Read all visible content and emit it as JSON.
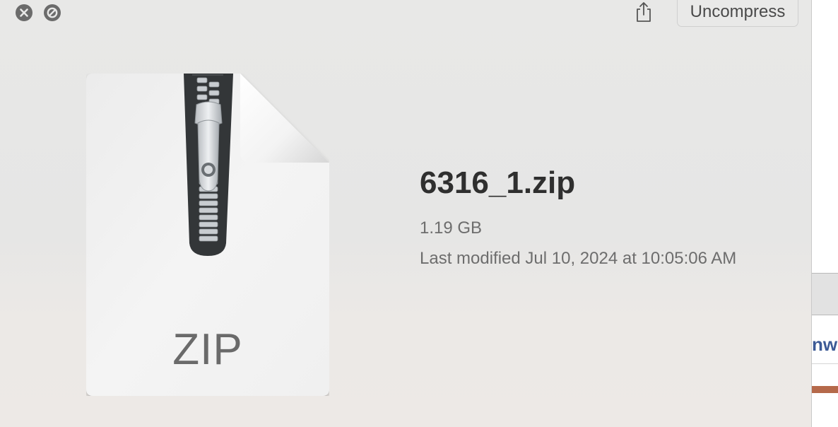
{
  "toolbar": {
    "close_icon": "close-icon",
    "disable_icon": "circle-slash-icon",
    "share_icon": "share-icon",
    "uncompress_label": "Uncompress"
  },
  "file": {
    "icon": "zip-archive-icon",
    "extension_label": "ZIP",
    "name": "6316_1.zip",
    "size": "1.19 GB",
    "modified": "Last modified Jul 10, 2024 at 10:05:06 AM"
  },
  "background_window": {
    "partial_text": "nw"
  },
  "colors": {
    "panel_background": "#e8e8e7",
    "title_text": "#2f2f2f",
    "secondary_text": "#6d6d6d",
    "button_icon": "#6b6b6b"
  }
}
